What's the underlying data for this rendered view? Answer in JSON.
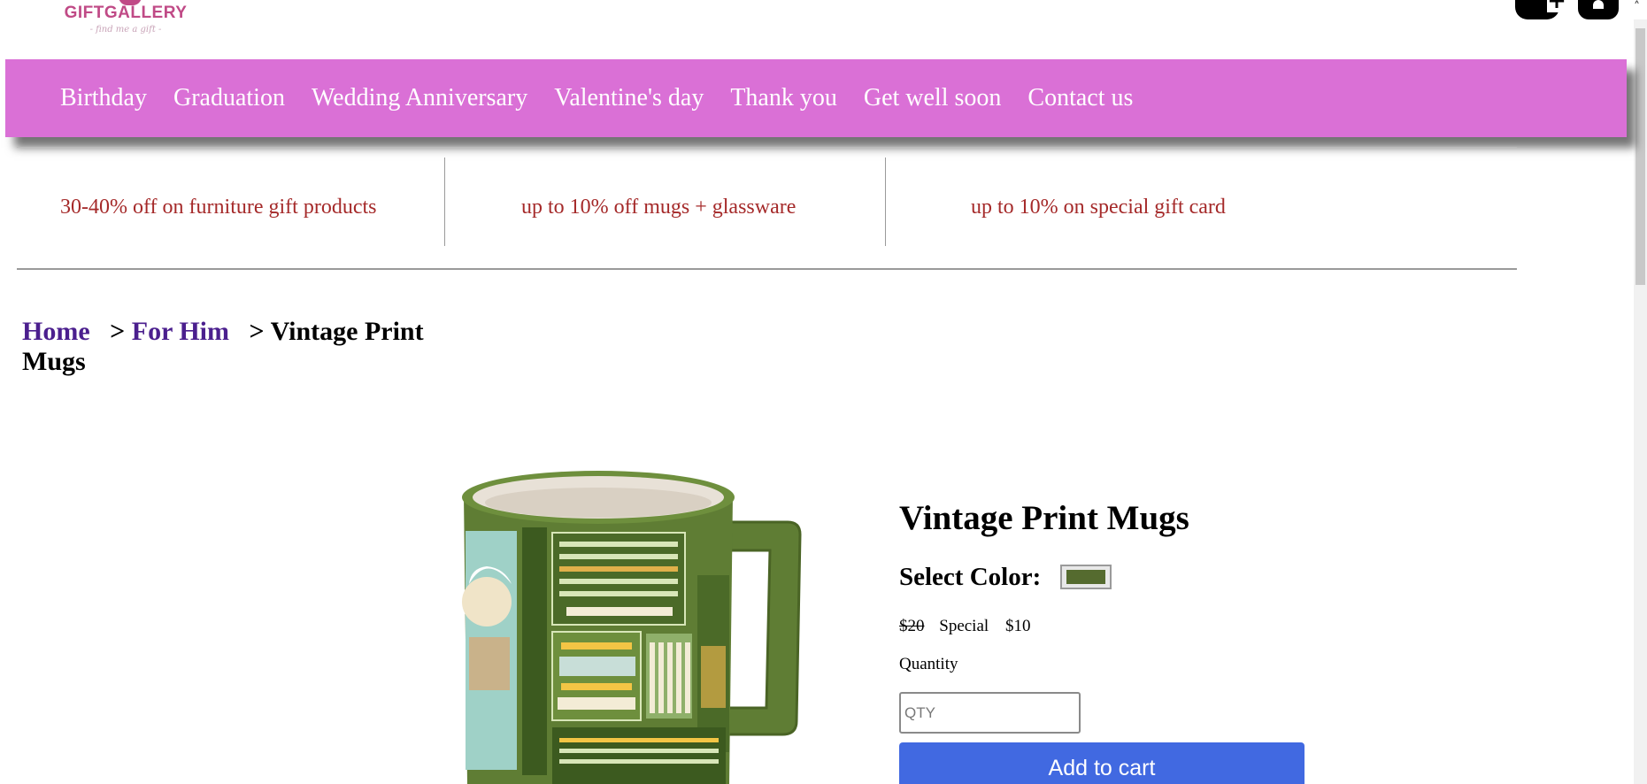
{
  "logo": {
    "title": "GIFTGALLERY",
    "tagline": "- find me a gift -"
  },
  "header_icons": [
    "add-user-icon",
    "basket-icon",
    "caret-up-icon"
  ],
  "nav": {
    "items": [
      {
        "label": "Birthday"
      },
      {
        "label": "Graduation"
      },
      {
        "label": "Wedding Anniversary"
      },
      {
        "label": "Valentine's day"
      },
      {
        "label": "Thank you"
      },
      {
        "label": "Get well soon"
      },
      {
        "label": "Contact us"
      }
    ]
  },
  "promos": [
    {
      "text": "30-40% off on furniture gift products"
    },
    {
      "text": "up to 10% off mugs + glassware"
    },
    {
      "text": "up to 10% on special gift card"
    }
  ],
  "breadcrumb": {
    "home": "Home",
    "sep1": "> ",
    "category": "For Him",
    "sep2": "> ",
    "current": "Vintage Print Mugs"
  },
  "product": {
    "title": "Vintage Print Mugs",
    "color_label": "Select Color:",
    "selected_color": "#556b2f",
    "price_old": "$20",
    "special_label": "Special",
    "price_special": "$10",
    "quantity_label": "Quantity",
    "quantity_placeholder": "QTY",
    "add_to_cart": "Add to cart"
  },
  "colors": {
    "nav_bg": "#da70d6",
    "promo_text": "#a52a2a",
    "breadcrumb_link": "#4b1f8e",
    "button_bg": "#4169e1",
    "mug_green": "#5f7d34"
  }
}
